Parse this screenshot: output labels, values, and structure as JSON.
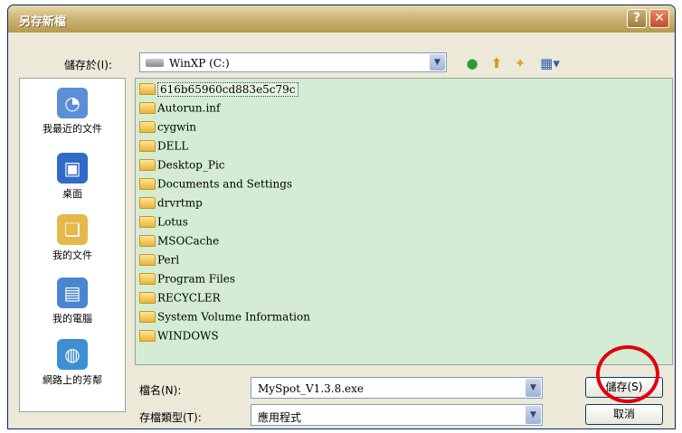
{
  "window": {
    "title": "另存新檔",
    "help_label": "?",
    "close_label": "✕"
  },
  "save_in": {
    "label": "儲存於(I):",
    "value": "WinXP (C:)"
  },
  "toolbar": {
    "back_glyph": "●",
    "up_glyph": "⬆",
    "new_folder_glyph": "✦",
    "views_glyph": "▦▾"
  },
  "places": [
    {
      "label": "我最近的文件",
      "icon": "recent-documents-icon",
      "color": "#5b8fd6"
    },
    {
      "label": "桌面",
      "icon": "desktop-icon",
      "color": "#2f6bc7"
    },
    {
      "label": "我的文件",
      "icon": "my-documents-icon",
      "color": "#e6b84a"
    },
    {
      "label": "我的電腦",
      "icon": "my-computer-icon",
      "color": "#4a86cf"
    },
    {
      "label": "網路上的芳鄰",
      "icon": "network-places-icon",
      "color": "#3d8fd1"
    }
  ],
  "files": [
    "616b65960cd883e5c79c",
    "Autorun.inf",
    "cygwin",
    "DELL",
    "Desktop_Pic",
    "Documents and Settings",
    "drvrtmp",
    "Lotus",
    "MSOCache",
    "Perl",
    "Program Files",
    "RECYCLER",
    "System Volume Information",
    "WINDOWS"
  ],
  "filename": {
    "label": "檔名(N):",
    "value": "MySpot_V1.3.8.exe"
  },
  "filetype": {
    "label": "存檔類型(T):",
    "value": "應用程式"
  },
  "buttons": {
    "save": "儲存(S)",
    "cancel": "取消"
  },
  "colors": {
    "list_background": "#d3ecd3",
    "highlight_circle": "#e0000f"
  }
}
